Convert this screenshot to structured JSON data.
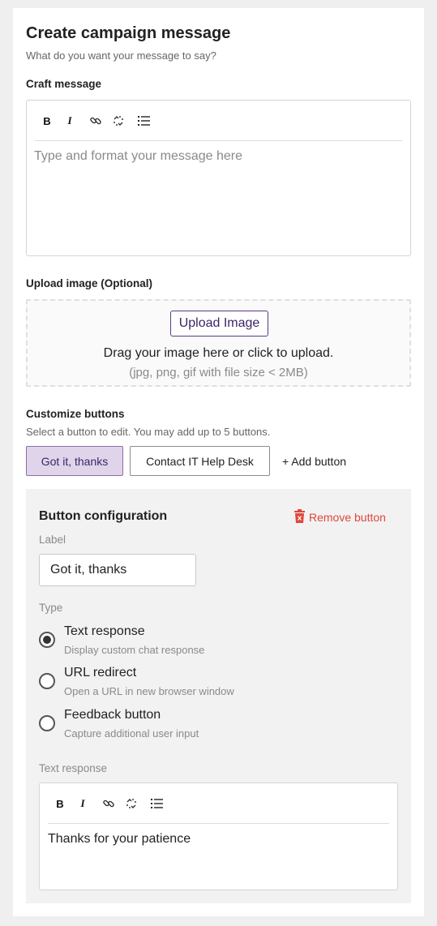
{
  "header": {
    "title": "Create campaign message",
    "subtitle": "What do you want your message to say?"
  },
  "craft": {
    "label": "Craft message",
    "placeholder": "Type and format your message here",
    "toolbar": {
      "bold": "B",
      "italic": "I"
    }
  },
  "upload": {
    "label": "Upload image (Optional)",
    "button_label": "Upload Image",
    "instruction": "Drag your image here or click to upload.",
    "hint": "(jpg, png, gif with file size < 2MB)"
  },
  "buttons": {
    "label": "Customize buttons",
    "description": "Select a button to edit. You may add up to 5 buttons.",
    "items": [
      {
        "label": "Got it, thanks",
        "selected": true
      },
      {
        "label": "Contact IT Help Desk",
        "selected": false
      }
    ],
    "add_label": "+ Add button"
  },
  "config": {
    "title": "Button configuration",
    "remove_label": "Remove button",
    "label_field": {
      "label": "Label",
      "value": "Got it, thanks"
    },
    "type_label": "Type",
    "types": [
      {
        "label": "Text response",
        "description": "Display custom chat response",
        "checked": true
      },
      {
        "label": "URL redirect",
        "description": "Open a URL in new browser window",
        "checked": false
      },
      {
        "label": "Feedback button",
        "description": "Capture additional user input",
        "checked": false
      }
    ],
    "text_response": {
      "label": "Text response",
      "content": "Thanks for your patience",
      "toolbar": {
        "bold": "B",
        "italic": "I"
      }
    }
  },
  "colors": {
    "accent": "#5b3b85",
    "selected_chip_bg": "#e0d4ea",
    "danger": "#e0463b"
  },
  "icons": [
    "bold-icon",
    "italic-icon",
    "link-icon",
    "unlink-icon",
    "bullet-list-icon",
    "trash-icon"
  ]
}
